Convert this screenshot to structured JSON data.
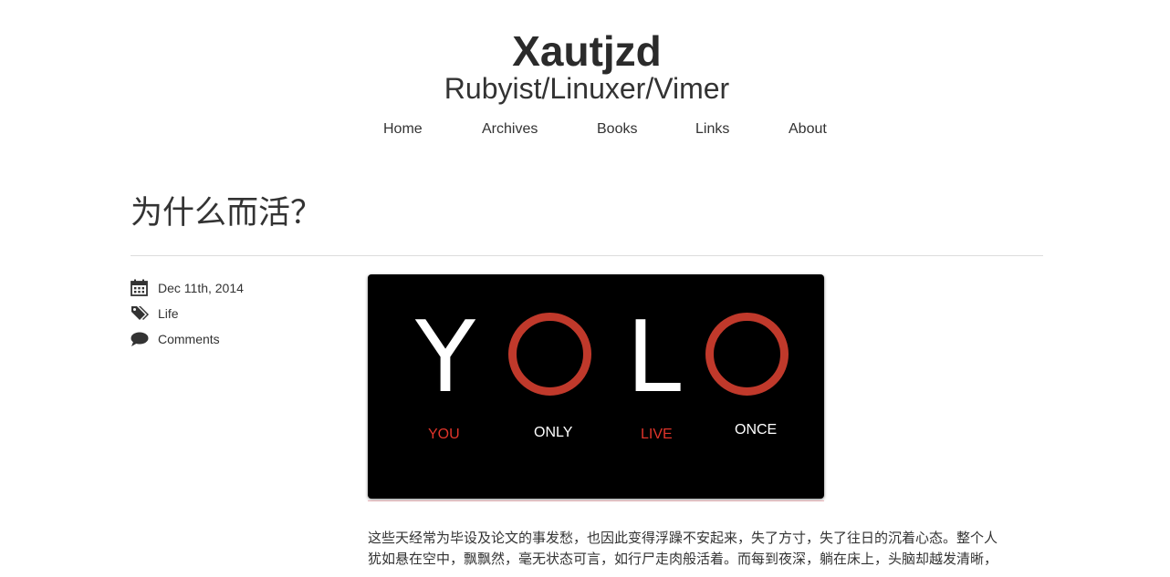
{
  "site": {
    "title": "Xautjzd",
    "subtitle": "Rubyist/Linuxer/Vimer"
  },
  "nav": {
    "items": [
      {
        "label": "Home"
      },
      {
        "label": "Archives"
      },
      {
        "label": "Books"
      },
      {
        "label": "Links"
      },
      {
        "label": "About"
      }
    ]
  },
  "post": {
    "title": "为什么而活？",
    "meta": {
      "date": "Dec 11th, 2014",
      "category": "Life",
      "comments": "Comments",
      "icons": [
        "calendar-icon",
        "tags-icon",
        "comment-icon"
      ]
    },
    "image": {
      "letters": [
        "Y",
        "O",
        "L",
        "O"
      ],
      "words": [
        "YOU",
        "ONLY",
        "LIVE",
        "ONCE"
      ],
      "colors": {
        "background": "#000000",
        "white": "#ffffff",
        "red": "#c0392b",
        "word_red": "#e0342a"
      }
    },
    "body_lines": [
      "这些天经常为毕设及论文的事发愁，也因此变得浮躁不安起来，失了方寸，失了往日的沉着心态。整个人",
      "犹如悬在空中，飘飘然，毫无状态可言，如行尸走肉般活着。而每到夜深，躺在床上，头脑却越发清晰，"
    ]
  }
}
